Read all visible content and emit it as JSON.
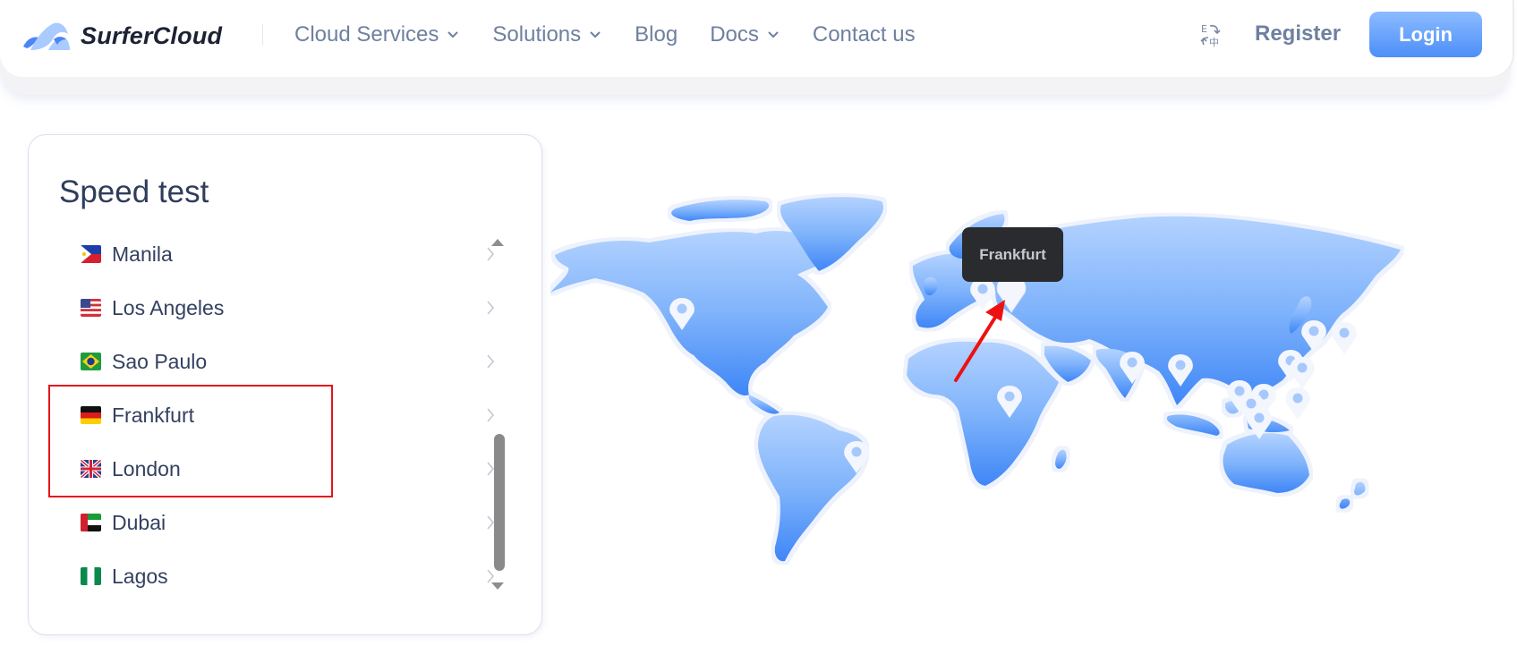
{
  "header": {
    "brand": "SurferCloud",
    "nav": [
      {
        "label": "Cloud Services",
        "has_dropdown": true
      },
      {
        "label": "Solutions",
        "has_dropdown": true
      },
      {
        "label": "Blog",
        "has_dropdown": false
      },
      {
        "label": "Docs",
        "has_dropdown": true
      },
      {
        "label": "Contact us",
        "has_dropdown": false
      }
    ],
    "language_icon": "translate-icon",
    "register_label": "Register",
    "login_label": "Login",
    "accent_color": "#4c8ff9"
  },
  "speed_test": {
    "title": "Speed test",
    "locations": [
      {
        "city": "Manila",
        "flag": "philippines-flag-icon"
      },
      {
        "city": "Los Angeles",
        "flag": "usa-flag-icon"
      },
      {
        "city": "Sao Paulo",
        "flag": "brazil-flag-icon"
      },
      {
        "city": "Frankfurt",
        "flag": "germany-flag-icon",
        "highlighted": true
      },
      {
        "city": "London",
        "flag": "uk-flag-icon",
        "highlighted": true
      },
      {
        "city": "Dubai",
        "flag": "uae-flag-icon"
      },
      {
        "city": "Lagos",
        "flag": "nigeria-flag-icon"
      }
    ],
    "highlight_color": "#e4141a"
  },
  "map": {
    "tooltip": "Frankfurt",
    "annotation": "red-arrow pointing to Frankfurt pin",
    "pins": [
      "Los Angeles",
      "Sao Paulo",
      "London",
      "Frankfurt",
      "Lagos",
      "Dubai",
      "Mumbai",
      "Seoul",
      "Tokyo",
      "Hong Kong",
      "Taipei",
      "Bangkok",
      "Ho Chi Minh City",
      "Kuala Lumpur",
      "Singapore",
      "Jakarta",
      "Manila"
    ]
  }
}
